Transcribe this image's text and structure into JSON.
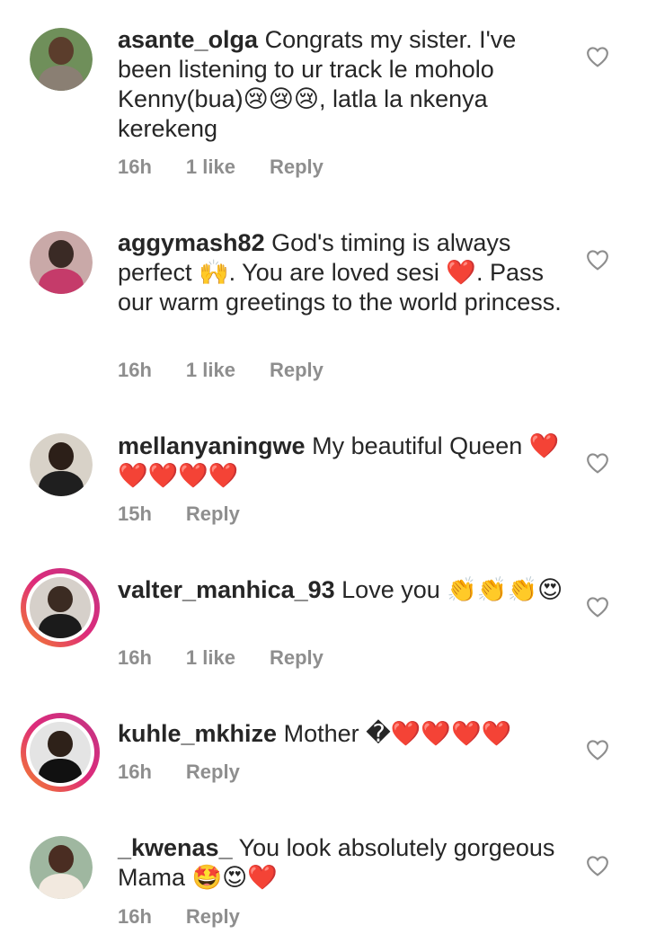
{
  "comments": [
    {
      "username": "asante_olga",
      "text": " Congrats my sister. I've been listening to ur track le moholo Kenny(bua)😢😢😢, latla la nkenya kerekeng",
      "time": "16h",
      "likes": "1 like",
      "reply": "Reply",
      "avatar_icon": "profile-photo",
      "story_ring": false
    },
    {
      "username": "aggymash82",
      "text": " God's timing is always perfect 🙌. You are loved sesi ❤️. Pass our warm greetings to the world princess.",
      "time": "16h",
      "likes": "1 like",
      "reply": "Reply",
      "avatar_icon": "profile-photo",
      "story_ring": false
    },
    {
      "username": "mellanyaningwe",
      "text": " My beautiful Queen ❤️❤️❤️❤️❤️",
      "time": "15h",
      "likes": "",
      "reply": "Reply",
      "avatar_icon": "profile-photo",
      "story_ring": false
    },
    {
      "username": "valter_manhica_93",
      "text": " Love you 👏👏👏😍",
      "time": "16h",
      "likes": "1 like",
      "reply": "Reply",
      "avatar_icon": "profile-photo",
      "story_ring": true
    },
    {
      "username": "kuhle_mkhize",
      "text": " Mother �❤️❤️❤️❤️",
      "time": "16h",
      "likes": "",
      "reply": "Reply",
      "avatar_icon": "profile-photo",
      "story_ring": true
    },
    {
      "username": "_kwenas_",
      "text": " You look absolutely gorgeous Mama 🤩😍❤️",
      "time": "16h",
      "likes": "",
      "reply": "Reply",
      "avatar_icon": "profile-photo",
      "story_ring": false
    }
  ],
  "colors": {
    "text": "#262626",
    "meta": "#8e8e8e",
    "heart_outline": "#8e8e8e",
    "story_ring_start": "#f58529",
    "story_ring_end": "#c13584"
  },
  "icons": {
    "like": "heart-outline-icon"
  }
}
